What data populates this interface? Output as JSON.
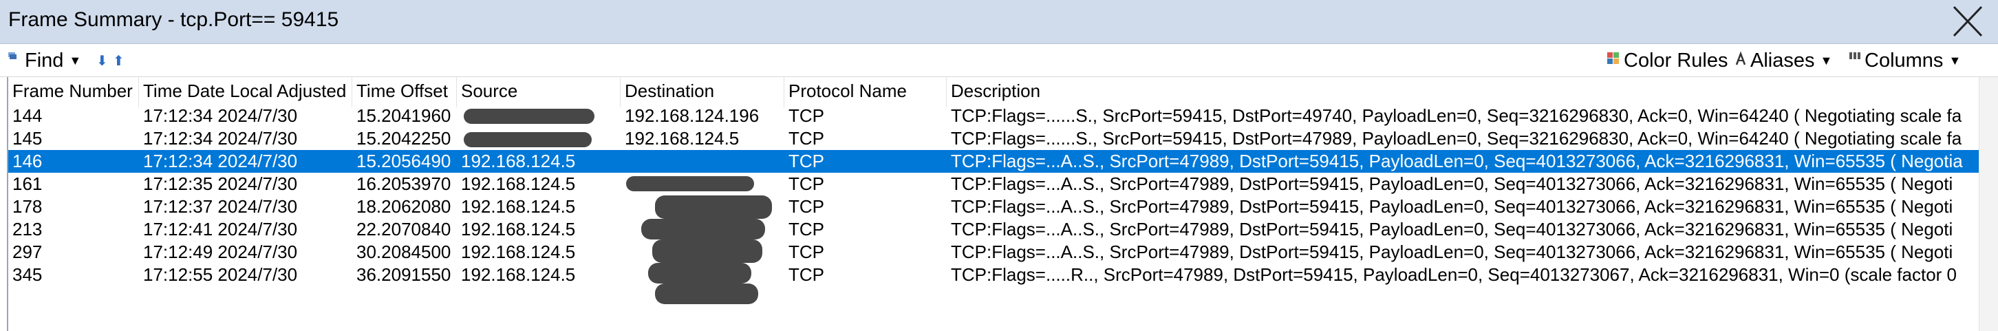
{
  "window": {
    "title": "Frame Summary - tcp.Port== 59415"
  },
  "toolbar": {
    "find_label": "Find",
    "color_rules_label": "Color Rules",
    "aliases_label": "Aliases",
    "columns_label": "Columns"
  },
  "columns": [
    "Frame Number",
    "Time Date Local Adjusted",
    "Time Offset",
    "Source",
    "Destination",
    "Protocol Name",
    "Description"
  ],
  "rows": [
    {
      "frame": "144",
      "time": "17:12:34 2024/7/30",
      "offset": "15.2041960",
      "source": "",
      "destination": "192.168.124.196",
      "protocol": "TCP",
      "description": "TCP:Flags=......S., SrcPort=59415, DstPort=49740, PayloadLen=0, Seq=3216296830, Ack=0, Win=64240 ( Negotiating scale fa"
    },
    {
      "frame": "145",
      "time": "17:12:34 2024/7/30",
      "offset": "15.2042250",
      "source": "",
      "destination": "192.168.124.5",
      "protocol": "TCP",
      "description": "TCP:Flags=......S., SrcPort=59415, DstPort=47989, PayloadLen=0, Seq=3216296830, Ack=0, Win=64240 ( Negotiating scale fa"
    },
    {
      "frame": "146",
      "time": "17:12:34 2024/7/30",
      "offset": "15.2056490",
      "source": "192.168.124.5",
      "destination": "",
      "protocol": "TCP",
      "description": "TCP:Flags=...A..S., SrcPort=47989, DstPort=59415, PayloadLen=0, Seq=4013273066, Ack=3216296831, Win=65535 ( Negotia",
      "selected": true
    },
    {
      "frame": "161",
      "time": "17:12:35 2024/7/30",
      "offset": "16.2053970",
      "source": "192.168.124.5",
      "destination": "",
      "protocol": "TCP",
      "description": "TCP:Flags=...A..S., SrcPort=47989, DstPort=59415, PayloadLen=0, Seq=4013273066, Ack=3216296831, Win=65535 ( Negoti"
    },
    {
      "frame": "178",
      "time": "17:12:37 2024/7/30",
      "offset": "18.2062080",
      "source": "192.168.124.5",
      "destination": "",
      "protocol": "TCP",
      "description": "TCP:Flags=...A..S., SrcPort=47989, DstPort=59415, PayloadLen=0, Seq=4013273066, Ack=3216296831, Win=65535 ( Negoti"
    },
    {
      "frame": "213",
      "time": "17:12:41 2024/7/30",
      "offset": "22.2070840",
      "source": "192.168.124.5",
      "destination": "",
      "protocol": "TCP",
      "description": "TCP:Flags=...A..S., SrcPort=47989, DstPort=59415, PayloadLen=0, Seq=4013273066, Ack=3216296831, Win=65535 ( Negoti"
    },
    {
      "frame": "297",
      "time": "17:12:49 2024/7/30",
      "offset": "30.2084500",
      "source": "192.168.124.5",
      "destination": "",
      "protocol": "TCP",
      "description": "TCP:Flags=...A..S., SrcPort=47989, DstPort=59415, PayloadLen=0, Seq=4013273066, Ack=3216296831, Win=65535 ( Negoti"
    },
    {
      "frame": "345",
      "time": "17:12:55 2024/7/30",
      "offset": "36.2091550",
      "source": "192.168.124.5",
      "destination": "",
      "protocol": "TCP",
      "description": "TCP:Flags=.....R.., SrcPort=47989, DstPort=59415, PayloadLen=0, Seq=4013273067, Ack=3216296831, Win=0 (scale factor 0"
    }
  ]
}
